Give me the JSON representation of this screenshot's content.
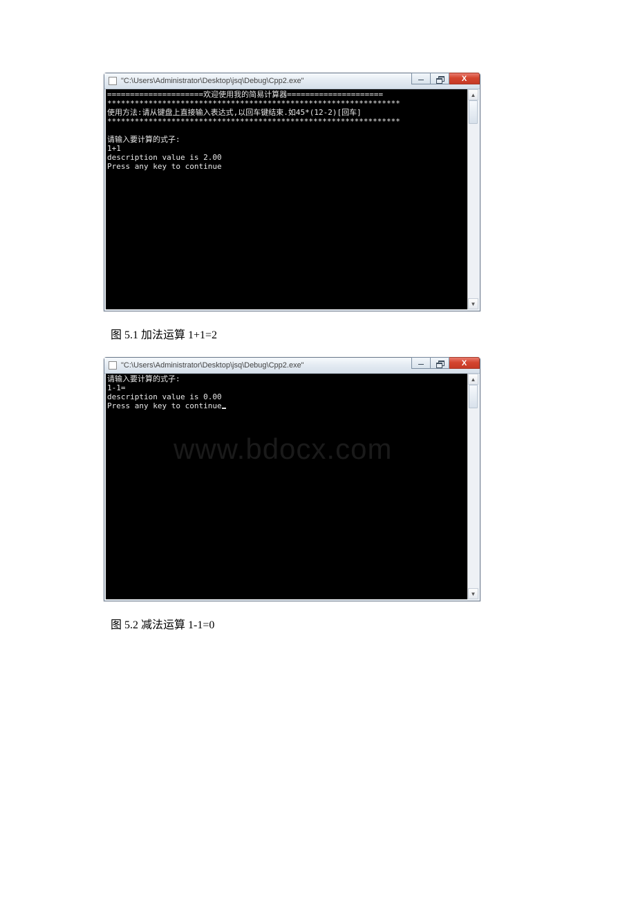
{
  "windows": [
    {
      "title": "\"C:\\Users\\Administrator\\Desktop\\jsq\\Debug\\Cpp2.exe\"",
      "console_height": 318,
      "thumb_top": 0,
      "thumb_height": 34,
      "lines": [
        "=====================欢迎使用我的简易计算器=====================",
        "****************************************************************",
        "使用方法:请从键盘上直接输入表达式,以回车键结束.如45*(12-2)[回车]",
        "****************************************************************",
        "",
        "请输入要计算的式子:",
        "1+1",
        "description value is 2.00",
        "Press any key to continue"
      ],
      "show_cursor": false
    },
    {
      "title": "\"C:\\Users\\Administrator\\Desktop\\jsq\\Debug\\Cpp2.exe\"",
      "console_height": 326,
      "thumb_top": 0,
      "thumb_height": 34,
      "lines": [
        "请输入要计算的式子:",
        "1-1=",
        "description value is 0.00",
        "Press any key to continue"
      ],
      "show_cursor": true
    }
  ],
  "captions": [
    "图 5.1 加法运算 1+1=2",
    "图 5.2 减法运算 1-1=0"
  ],
  "watermark": "www.bdocx.com",
  "close_glyph": "X",
  "up_glyph": "▲",
  "down_glyph": "▼"
}
